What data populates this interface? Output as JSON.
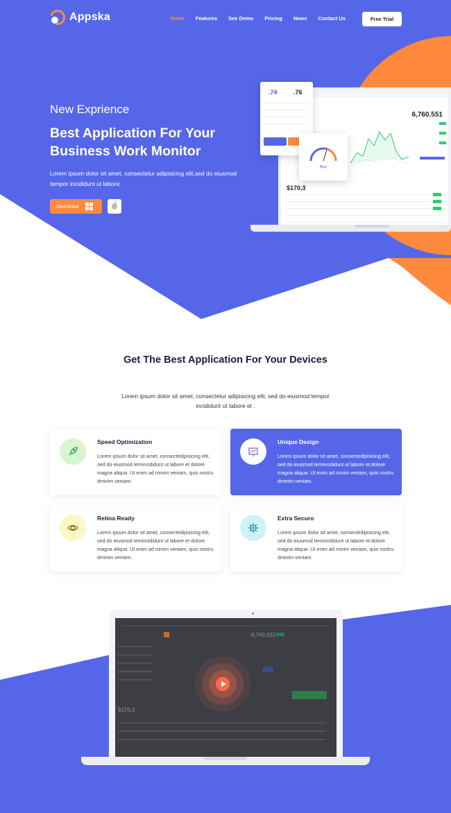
{
  "colors": {
    "primary": "#5567e8",
    "accent": "#ff8a3d",
    "text_dark": "#1b1e3c",
    "white": "#ffffff"
  },
  "nav": {
    "logo_text": "Appska",
    "items": [
      {
        "label": "Home",
        "active": true
      },
      {
        "label": "Features",
        "active": false
      },
      {
        "label": "See Demo",
        "active": false
      },
      {
        "label": "Pricing",
        "active": false
      },
      {
        "label": "News",
        "active": false
      },
      {
        "label": "Contact Us",
        "active": false
      }
    ],
    "cta": "Free Trial"
  },
  "hero": {
    "kicker": "New Exprience",
    "title": "Best Application For Your Business Work Monitor",
    "description": "Lorem ipsum dolor sit amet, consectetur adipisicing elit,sed do eiusmod tempor incididunt ut labore.",
    "download_label": "Download",
    "download_icon": "windows-icon",
    "apple_icon": "apple-icon",
    "mockup": {
      "stat_a": ".74",
      "stat_b": ".76",
      "price": "6,760.551",
      "balance": "$170,3",
      "gauge_label": "Buy"
    }
  },
  "features": {
    "title": "Get The Best Application For Your Devices",
    "description": "Lorem ipsum dolor sit amet, consectetur adipisicing elit, sed do eiusmod tempor incididunt ut labore et .",
    "cards": [
      {
        "title": "Speed Optimization",
        "text": "Lorem ipsum dolor sit amet, consectedipisicing elit, sed do eiusmod temincididunt ut labore et dolore magna aliqua. Ut enim ad minim veniam, quis nostru dminim veniam.",
        "icon": "rocket-icon",
        "icon_bg": "#d6f5d0",
        "featured": false
      },
      {
        "title": "Unique Design",
        "text": "Lorem ipsum dolor sit amet, consectedipisicing elit, sed do eiusmod temincididunt ut labore et dolore magna aliqua. Ut enim ad minim veniam, quis nostru dminim veniam.",
        "icon": "design-board-icon",
        "icon_bg": "#ffffff",
        "featured": true
      },
      {
        "title": "Retina Ready",
        "text": "Lorem ipsum dolor sit amet, consectedipisicing elit, sed do eiusmod temincididunt ut labore et dolore magna aliqua. Ut enim ad minim veniam, quis nostru dminim veniam.",
        "icon": "eye-icon",
        "icon_bg": "#fdf7c3",
        "featured": false
      },
      {
        "title": "Extra Securo",
        "text": "Lorem ipsum dolor sit amet, consectedipisicing elit, sed do eiusmod temincididunt ut labore et dolore magna aliqua. Ut enim ad minim veniam, quis nostru dminim veniam.",
        "icon": "gear-shield-icon",
        "icon_bg": "#cdf2f7",
        "featured": false
      }
    ]
  },
  "video": {
    "play_icon": "play-icon",
    "screen_price": "6,760.551",
    "screen_balance": "$170,3"
  }
}
